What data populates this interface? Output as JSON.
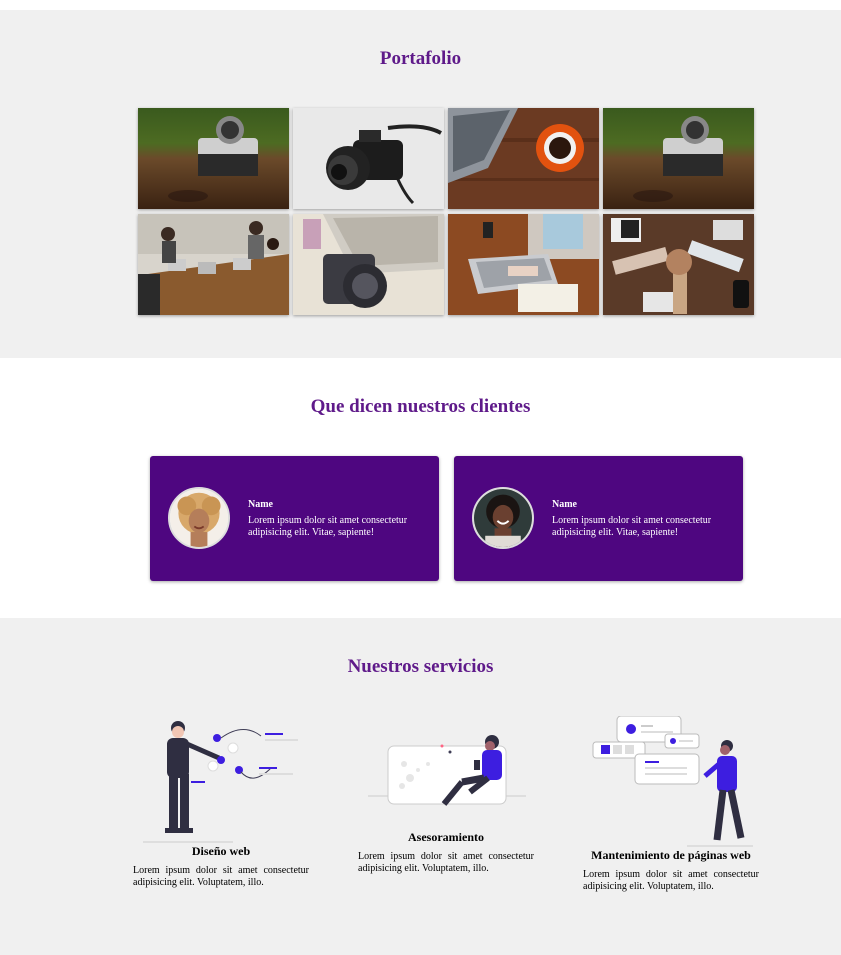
{
  "portfolio": {
    "title": "Portafolio",
    "images": [
      {
        "name": "camera-on-table"
      },
      {
        "name": "dslr-camera"
      },
      {
        "name": "laptop-and-coffee"
      },
      {
        "name": "camera-on-table"
      },
      {
        "name": "team-meeting"
      },
      {
        "name": "camera-and-laptop"
      },
      {
        "name": "typing-on-laptop"
      },
      {
        "name": "team-fist-bump"
      }
    ]
  },
  "testimonials": {
    "title": "Que dicen nuestros clientes",
    "cards": [
      {
        "name": "Name",
        "text": "Lorem ipsum dolor sit amet consectetur adipisicing elit. Vitae, sapiente!"
      },
      {
        "name": "Name",
        "text": "Lorem ipsum dolor sit amet consectetur adipisicing elit. Vitae, sapiente!"
      }
    ]
  },
  "services": {
    "title": "Nuestros servicios",
    "items": [
      {
        "title": "Diseño web",
        "text": "Lorem ipsum dolor sit amet consectetur adipisicing elit. Voluptatem, illo."
      },
      {
        "title": "Asesoramiento",
        "text": "Lorem ipsum dolor sit amet consectetur adipisicing elit. Voluptatem, illo."
      },
      {
        "title": "Mantenimiento de páginas web",
        "text": "Lorem ipsum dolor sit amet consectetur adipisicing elit. Voluptatem, illo."
      }
    ]
  },
  "colors": {
    "accent": "#5f1a8a",
    "card": "#4e0680",
    "illustration": "#3d1ee0",
    "section_gray": "#f0f0f0"
  }
}
